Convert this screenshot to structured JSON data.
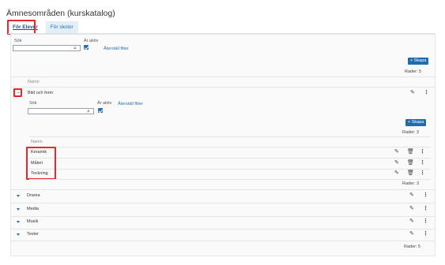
{
  "page": {
    "title": "Ämnesområden (kurskatalog)"
  },
  "tabs": [
    {
      "label": "För Elever",
      "active": true
    },
    {
      "label": "För skolor",
      "active": false
    }
  ],
  "filters": {
    "search_label": "Sök",
    "search_value": "",
    "active_label": "Är aktiv",
    "active_checked": true,
    "reset_label": "Återställ filter"
  },
  "toolbar": {
    "create_label": "+ Skapa",
    "rows_label": "Rader: 5"
  },
  "table": {
    "column_header": "Namn",
    "rows": [
      {
        "name": "Bild och form",
        "expanded": true
      },
      {
        "name": "Drama",
        "expanded": false
      },
      {
        "name": "Media",
        "expanded": false
      },
      {
        "name": "Musik",
        "expanded": false
      },
      {
        "name": "Texter",
        "expanded": false
      }
    ],
    "footer_rows_label": "Rader: 5"
  },
  "sub": {
    "filters": {
      "search_label": "Sök",
      "search_value": "",
      "active_label": "Är aktiv",
      "active_checked": true,
      "reset_label": "Återställ filter"
    },
    "create_label": "+ Skapa",
    "rows_label_top": "Rader: 3",
    "column_header": "Namn",
    "rows": [
      {
        "name": "Keramik"
      },
      {
        "name": "Måleri"
      },
      {
        "name": "Teckning"
      }
    ],
    "rows_label_bottom": "Rader: 3"
  },
  "icons": {
    "edit": "pencil-icon",
    "delete": "trash-icon",
    "more": "kebab-icon",
    "search": "search-icon",
    "expand": "caret-down-icon",
    "collapse": "minus-icon"
  },
  "colors": {
    "accent": "#1f6cae",
    "highlight": "#e8262b",
    "link": "#2a6fb0"
  }
}
